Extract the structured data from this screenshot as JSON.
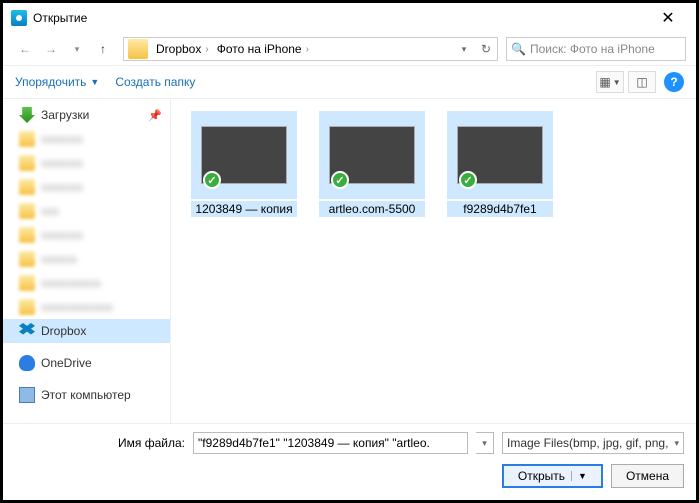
{
  "window": {
    "title": "Открытие"
  },
  "nav": {
    "crumbs": [
      "Dropbox",
      "Фото на iPhone"
    ],
    "search_placeholder": "Поиск: Фото на iPhone"
  },
  "toolbar": {
    "organize": "Упорядочить",
    "newfolder": "Создать папку"
  },
  "tree": {
    "downloads": "Загрузки",
    "dropbox": "Dropbox",
    "onedrive": "OneDrive",
    "thispc": "Этот компьютер"
  },
  "thumbs": [
    {
      "name": "1203849 — копия"
    },
    {
      "name": "artleo.com-5500"
    },
    {
      "name": "f9289d4b7fe1"
    }
  ],
  "footer": {
    "label": "Имя файла:",
    "value": "\"f9289d4b7fe1\" \"1203849 — копия\" \"artleo.",
    "filter": "Image Files(bmp, jpg, gif, png,",
    "open": "Открыть",
    "cancel": "Отмена"
  }
}
